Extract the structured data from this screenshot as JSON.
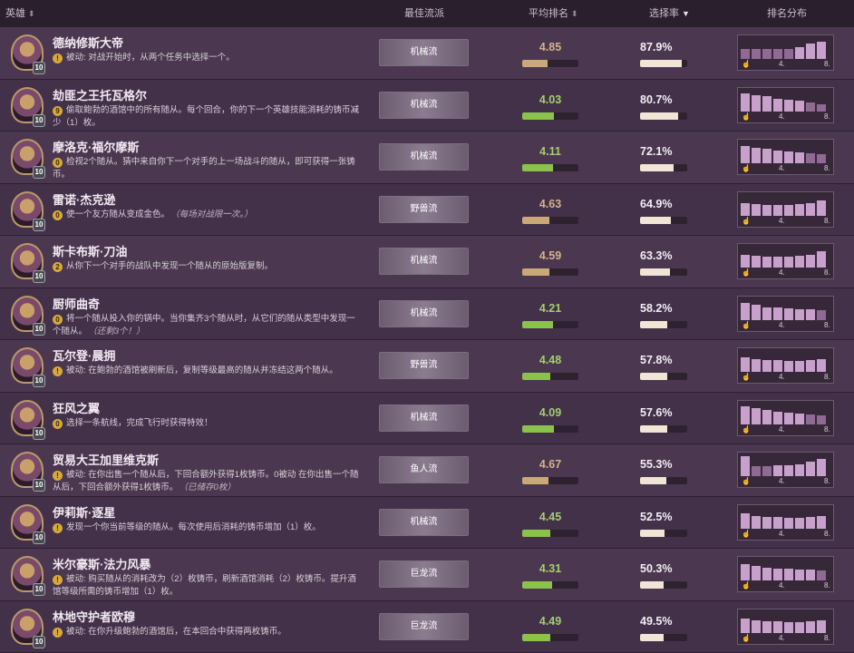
{
  "header": {
    "hero": "英雄",
    "build": "最佳流派",
    "avg_rank": "平均排名",
    "pick_rate": "选择率",
    "distribution": "排名分布",
    "sort_icon": "⬍",
    "sort_desc_icon": "▼"
  },
  "dist_labels": {
    "mid": "4.",
    "end": "8."
  },
  "colors": {
    "good": "#a4cf6a",
    "mid": "#d2b389",
    "bar_good": "#8bc34a",
    "bar_mid": "#c9a978"
  },
  "rows": [
    {
      "name": "德纳修斯大帝",
      "armor": "10",
      "cost": "!",
      "power": "被动: 对战开始时，从两个任务中选择一个。",
      "bold_prefix": true,
      "note": "",
      "build": "机械流",
      "avg": "4.85",
      "avg_value": 4.85,
      "avg_tone": "mid",
      "pick": "87.9%",
      "pick_value": 0.879,
      "dist": [
        0.45,
        0.45,
        0.45,
        0.45,
        0.45,
        0.55,
        0.7,
        0.8
      ]
    },
    {
      "name": "劫匪之王托瓦格尔",
      "armor": "10",
      "cost": "9",
      "power": "偷取鲍勃的酒馆中的所有随从。每个回合，你的下一个英雄技能消耗的铸币减少（1）枚。",
      "bold_prefix": false,
      "note": "",
      "build": "机械流",
      "avg": "4.03",
      "avg_value": 4.03,
      "avg_tone": "good",
      "pick": "80.7%",
      "pick_value": 0.807,
      "dist": [
        0.85,
        0.75,
        0.7,
        0.6,
        0.55,
        0.5,
        0.4,
        0.35
      ]
    },
    {
      "name": "摩洛克·福尔摩斯",
      "armor": "10",
      "cost": "0",
      "power": "检视2个随从。猜中来自你下一个对手的上一场战斗的随从，即可获得一张铸币。",
      "bold_prefix": false,
      "note": "",
      "build": "机械流",
      "avg": "4.11",
      "avg_value": 4.11,
      "avg_tone": "good",
      "pick": "72.1%",
      "pick_value": 0.721,
      "dist": [
        0.8,
        0.7,
        0.65,
        0.6,
        0.55,
        0.5,
        0.45,
        0.4
      ]
    },
    {
      "name": "雷诺·杰克逊",
      "armor": "10",
      "cost": "0",
      "power": "使一个友方随从变成金色。",
      "bold_prefix": false,
      "note": "（每场对战限一次。）",
      "build": "野兽流",
      "avg": "4.63",
      "avg_value": 4.63,
      "avg_tone": "mid",
      "pick": "64.9%",
      "pick_value": 0.649,
      "dist": [
        0.6,
        0.55,
        0.5,
        0.5,
        0.5,
        0.55,
        0.6,
        0.7
      ]
    },
    {
      "name": "斯卡布斯·刀油",
      "armor": "10",
      "cost": "2",
      "power": "从你下一个对手的战队中发现一个随从的原始版复制。",
      "bold_prefix": false,
      "note": "",
      "build": "机械流",
      "avg": "4.59",
      "avg_value": 4.59,
      "avg_tone": "mid",
      "pick": "63.3%",
      "pick_value": 0.633,
      "dist": [
        0.6,
        0.55,
        0.5,
        0.5,
        0.5,
        0.55,
        0.6,
        0.75
      ]
    },
    {
      "name": "厨师曲奇",
      "armor": "10",
      "cost": "0",
      "power": "将一个随从投入你的锅中。当你集齐3个随从时，从它们的随从类型中发现一个随从。",
      "bold_prefix": false,
      "note": "（还剩3个！）",
      "build": "机械流",
      "avg": "4.21",
      "avg_value": 4.21,
      "avg_tone": "good",
      "pick": "58.2%",
      "pick_value": 0.582,
      "dist": [
        0.8,
        0.7,
        0.6,
        0.6,
        0.55,
        0.5,
        0.5,
        0.45
      ]
    },
    {
      "name": "瓦尔登·晨拥",
      "armor": "10",
      "cost": "!",
      "power": "被动: 在鲍勃的酒馆被刷新后，复制等级最高的随从并冻结这两个随从。",
      "bold_prefix": true,
      "note": "",
      "build": "野兽流",
      "avg": "4.48",
      "avg_value": 4.48,
      "avg_tone": "good",
      "pick": "57.8%",
      "pick_value": 0.578,
      "dist": [
        0.65,
        0.6,
        0.55,
        0.55,
        0.5,
        0.5,
        0.55,
        0.6
      ]
    },
    {
      "name": "狂风之翼",
      "armor": "10",
      "cost": "0",
      "power": "选择一条航线，完成飞行时获得特效！",
      "bold_prefix": false,
      "note": "",
      "build": "机械流",
      "avg": "4.09",
      "avg_value": 4.09,
      "avg_tone": "good",
      "pick": "57.6%",
      "pick_value": 0.576,
      "dist": [
        0.85,
        0.75,
        0.65,
        0.6,
        0.55,
        0.5,
        0.45,
        0.4
      ]
    },
    {
      "name": "贸易大王加里维克斯",
      "armor": "10",
      "cost": "!",
      "power": "被动: 在你出售一个随从后，下回合额外获得1枚铸币。0被动 在你出售一个随从后，下回合额外获得1枚铸币。",
      "bold_prefix": true,
      "note": "（已储存0枚）",
      "build": "鱼人流",
      "avg": "4.67",
      "avg_value": 4.67,
      "avg_tone": "mid",
      "pick": "55.3%",
      "pick_value": 0.553,
      "dist": [
        0.9,
        0.45,
        0.45,
        0.5,
        0.5,
        0.55,
        0.65,
        0.8
      ]
    },
    {
      "name": "伊莉斯·逐星",
      "armor": "10",
      "cost": "!",
      "power": "发现一个你当前等级的随从。每次使用后消耗的铸币增加（1）枚。",
      "bold_prefix": false,
      "note": "",
      "build": "机械流",
      "avg": "4.45",
      "avg_value": 4.45,
      "avg_tone": "good",
      "pick": "52.5%",
      "pick_value": 0.525,
      "dist": [
        0.7,
        0.6,
        0.55,
        0.55,
        0.5,
        0.5,
        0.55,
        0.6
      ]
    },
    {
      "name": "米尔豪斯·法力风暴",
      "armor": "10",
      "cost": "!",
      "power": "被动: 购买随从的消耗改为（2）枚铸币，刷新酒馆消耗（2）枚铸币。提升酒馆等级所需的铸币增加（1）枚。",
      "bold_prefix": true,
      "note": "",
      "build": "巨龙流",
      "avg": "4.31",
      "avg_value": 4.31,
      "avg_tone": "good",
      "pick": "50.3%",
      "pick_value": 0.503,
      "dist": [
        0.75,
        0.65,
        0.6,
        0.55,
        0.55,
        0.5,
        0.5,
        0.45
      ]
    },
    {
      "name": "林地守护者欧穆",
      "armor": "10",
      "cost": "!",
      "power": "被动: 在你升级鲍勃的酒馆后，在本回合中获得两枚铸币。",
      "bold_prefix": true,
      "note": "",
      "build": "巨龙流",
      "avg": "4.49",
      "avg_value": 4.49,
      "avg_tone": "good",
      "pick": "49.5%",
      "pick_value": 0.495,
      "dist": [
        0.65,
        0.6,
        0.55,
        0.55,
        0.5,
        0.5,
        0.55,
        0.6
      ]
    }
  ]
}
